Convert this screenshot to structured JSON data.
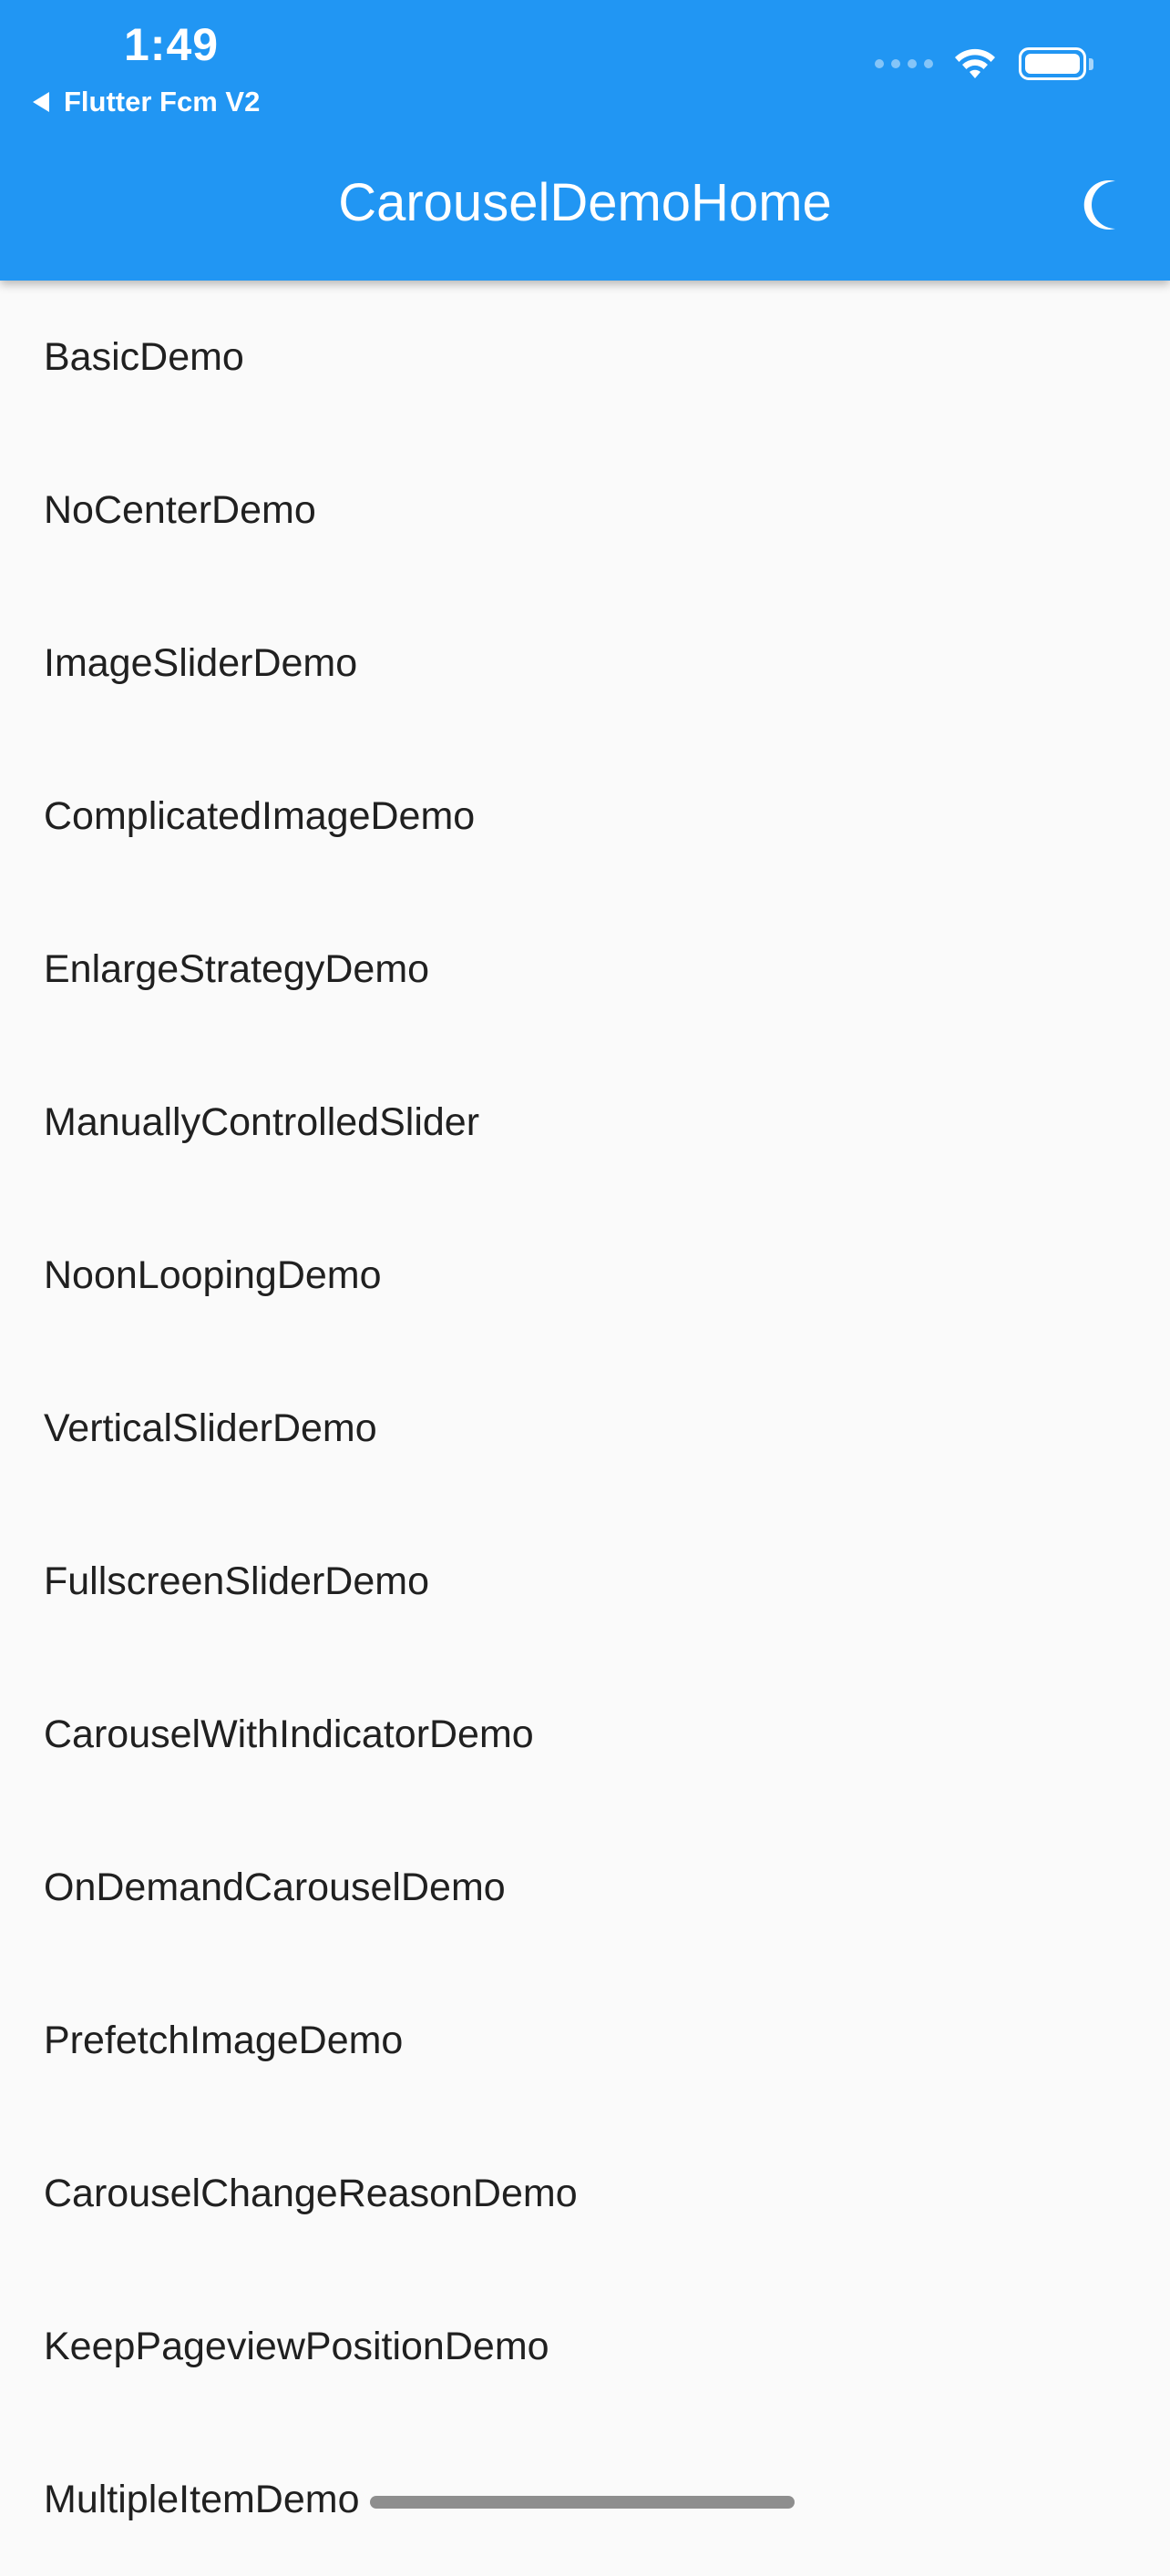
{
  "status_bar": {
    "time": "1:49",
    "back_app": "Flutter Fcm V2",
    "icons": [
      "cellular-dots-icon",
      "wifi-icon",
      "battery-icon"
    ]
  },
  "app_bar": {
    "title": "CarouselDemoHome",
    "action_icon": "moon-icon",
    "background_color": "#2196F3"
  },
  "list": {
    "items": [
      {
        "label": "BasicDemo"
      },
      {
        "label": "NoCenterDemo"
      },
      {
        "label": "ImageSliderDemo"
      },
      {
        "label": "ComplicatedImageDemo"
      },
      {
        "label": "EnlargeStrategyDemo"
      },
      {
        "label": "ManuallyControlledSlider"
      },
      {
        "label": "NoonLoopingDemo"
      },
      {
        "label": "VerticalSliderDemo"
      },
      {
        "label": "FullscreenSliderDemo"
      },
      {
        "label": "CarouselWithIndicatorDemo"
      },
      {
        "label": "OnDemandCarouselDemo"
      },
      {
        "label": "PrefetchImageDemo"
      },
      {
        "label": "CarouselChangeReasonDemo"
      },
      {
        "label": "KeepPageviewPositionDemo"
      },
      {
        "label": "MultipleItemDemo"
      }
    ]
  }
}
